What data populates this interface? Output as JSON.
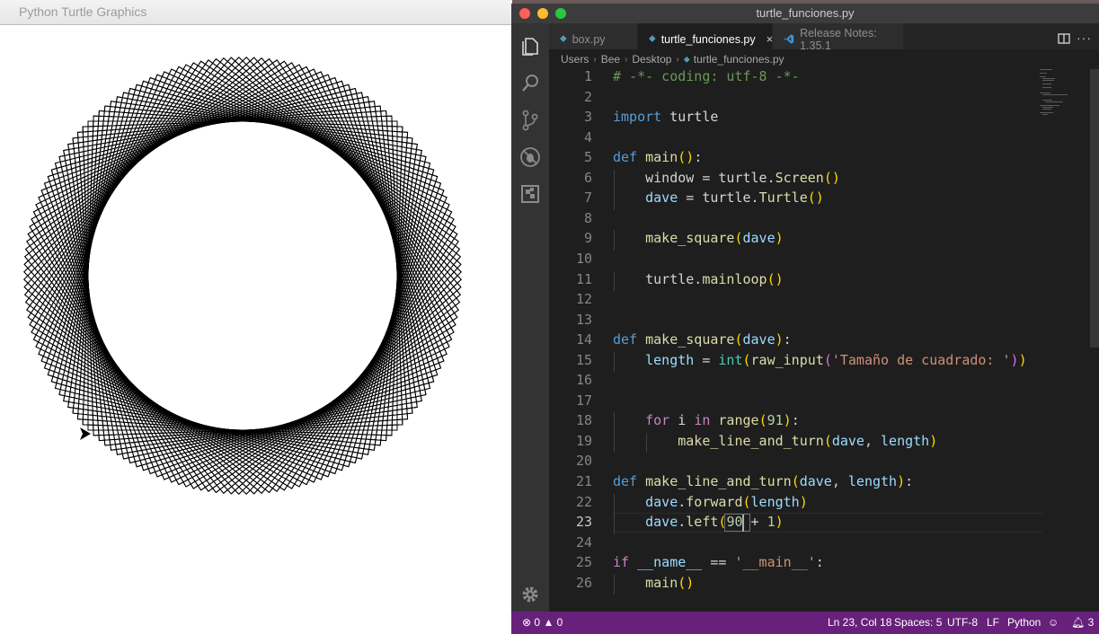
{
  "turtle_window": {
    "title": "Python Turtle Graphics"
  },
  "vscode": {
    "title": "turtle_funciones.py",
    "tabs": [
      {
        "label": "box.py",
        "icon": "python-file-icon"
      },
      {
        "label": "turtle_funciones.py",
        "icon": "python-file-icon",
        "active": true,
        "close": "×"
      },
      {
        "label": "Release Notes: 1.35.1",
        "icon": "vscode-logo-icon"
      }
    ],
    "breadcrumb": [
      "Users",
      "Bee",
      "Desktop",
      "turtle_funciones.py"
    ],
    "current_line": 23,
    "line_numbers": [
      1,
      2,
      3,
      4,
      5,
      6,
      7,
      8,
      9,
      10,
      11,
      12,
      13,
      14,
      15,
      16,
      17,
      18,
      19,
      20,
      21,
      22,
      23,
      24,
      25,
      26
    ],
    "code": [
      "# -*- coding: utf-8 -*-",
      "",
      "import turtle",
      "",
      "def main():",
      "    window = turtle.Screen()",
      "    dave = turtle.Turtle()",
      "",
      "    make_square(dave)",
      "",
      "    turtle.mainloop()",
      "",
      "",
      "def make_square(dave):",
      "    length = int(raw_input('Tamaño de cuadrado: '))",
      "",
      "",
      "    for i in range(91):",
      "        make_line_and_turn(dave, length)",
      "",
      "def make_line_and_turn(dave, length):",
      "    dave.forward(length)",
      "    dave.left(90 + 1)",
      "",
      "if __name__ == '__main__':",
      "    main()"
    ],
    "statusbar": {
      "errors": "0",
      "warnings": "0",
      "position": "Ln 23, Col 18",
      "spaces": "Spaces: 5",
      "encoding": "UTF-8",
      "eol": "LF",
      "language": "Python",
      "notifications": "3"
    },
    "colors": {
      "statusbar": "#68217a",
      "editor_bg": "#1e1e1e",
      "keyword": "#569cd6",
      "function": "#dcdcaa",
      "string": "#ce9178",
      "comment": "#6a9955"
    }
  }
}
